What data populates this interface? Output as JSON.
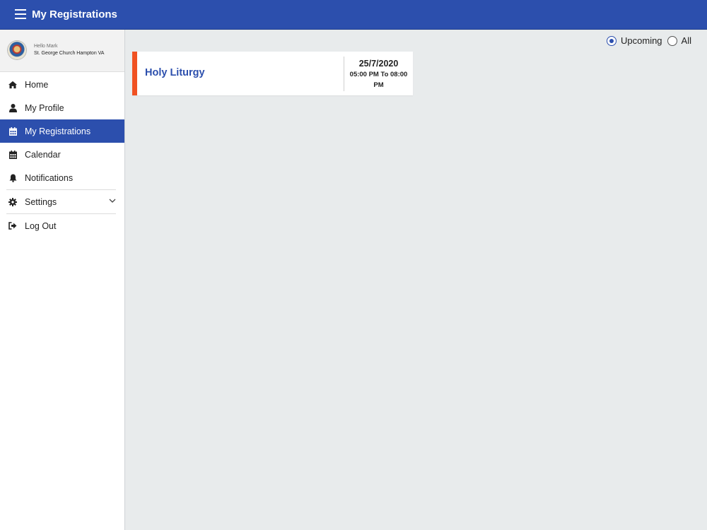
{
  "header": {
    "title": "My Registrations"
  },
  "user": {
    "greeting": "Hello Mark",
    "church": "St. George Church Hampton VA"
  },
  "nav": {
    "home": "Home",
    "profile": "My Profile",
    "registrations": "My Registrations",
    "calendar": "Calendar",
    "notifications": "Notifications",
    "settings": "Settings",
    "logout": "Log Out"
  },
  "filter": {
    "upcoming": "Upcoming",
    "all": "All",
    "selected": "Upcoming"
  },
  "registration": {
    "event": "Holy Liturgy",
    "date": "25/7/2020",
    "time": "05:00 PM To 08:00 PM"
  },
  "colors": {
    "primary": "#2c4fad",
    "accent": "#f05122",
    "background": "#e8ebec"
  }
}
